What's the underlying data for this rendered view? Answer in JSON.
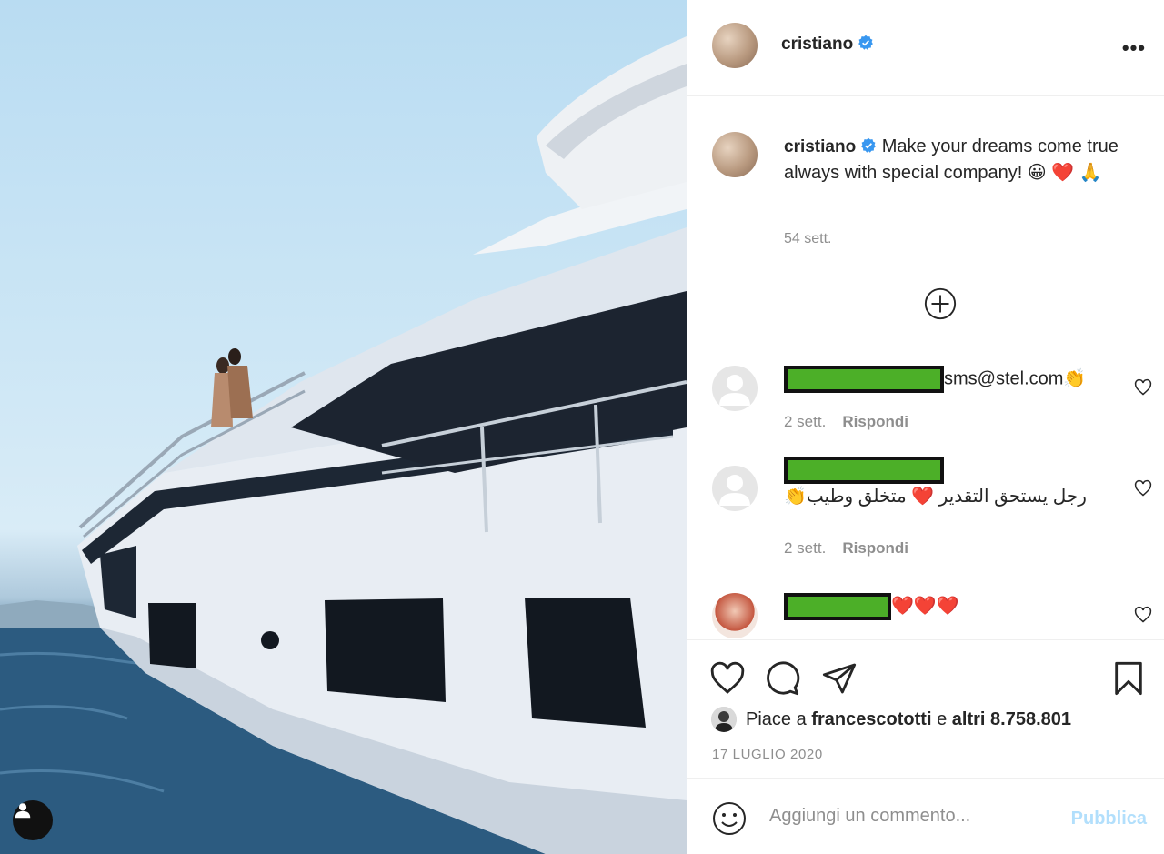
{
  "post": {
    "username": "cristiano",
    "verified": true,
    "more_label": "•••"
  },
  "caption": {
    "username": "cristiano",
    "text": "Make your dreams come true always with special company! 😀 ❤️ 🙏",
    "time": "54 sett."
  },
  "load_more_icon": "plus-circle-icon",
  "comments": [
    {
      "text": "sms@stel.com👏",
      "time": "2 sett.",
      "reply_label": "Rispondi",
      "redacted": true
    },
    {
      "text": "رجل يستحق التقدير ❤️ متخلق وطيب👏",
      "time": "2 sett.",
      "reply_label": "Rispondi",
      "redacted": true
    },
    {
      "text": "❤️❤️❤️",
      "redacted": true
    }
  ],
  "actions": {
    "like_icon": "heart-icon",
    "comment_icon": "comment-icon",
    "share_icon": "paper-plane-icon",
    "save_icon": "bookmark-icon"
  },
  "likes": {
    "prefix": "Piace a",
    "user": "francescototti",
    "joiner": "e",
    "others": "altri 8.758.801"
  },
  "date": "17 LUGLIO 2020",
  "add_comment": {
    "placeholder": "Aggiungi un commento...",
    "publish_label": "Pubblica"
  },
  "colors": {
    "verified_blue": "#3897f0",
    "muted": "#8e8e8e",
    "publish_disabled": "#b2dffc",
    "redaction_green": "#4caf28"
  }
}
